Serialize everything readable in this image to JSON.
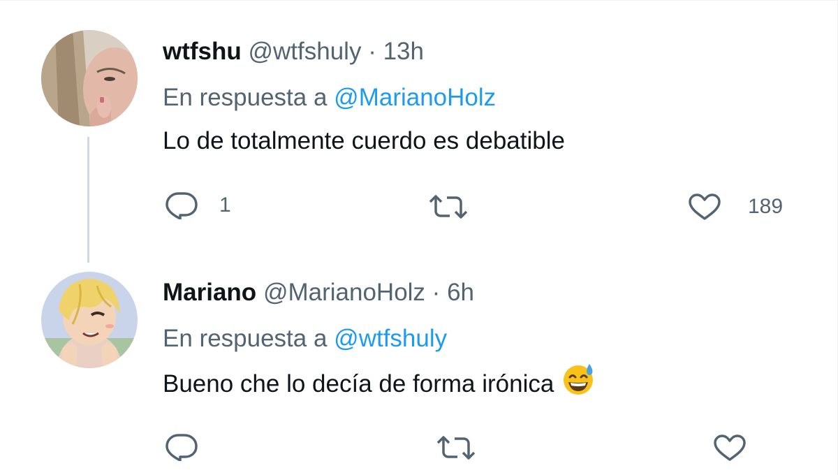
{
  "tweets": [
    {
      "display_name": "wtfshu",
      "handle": "@wtfshuly",
      "separator": "·",
      "time": "13h",
      "reply_prefix": "En respuesta a",
      "reply_to": "@MarianoHolz",
      "text": "Lo de totalmente cuerdo es debatible",
      "reply_count": "1",
      "retweet_count": "",
      "like_count": "189",
      "icons": {
        "reply": "reply-icon",
        "retweet": "retweet-icon",
        "like": "heart-icon"
      }
    },
    {
      "display_name": "Mariano",
      "handle": "@MarianoHolz",
      "separator": "·",
      "time": "6h",
      "reply_prefix": "En respuesta a",
      "reply_to": "@wtfshuly",
      "text": "Bueno che lo decía de forma irónica",
      "emoji": "grinning-face-with-sweat-emoji",
      "reply_count": "",
      "retweet_count": "",
      "like_count": "",
      "icons": {
        "reply": "reply-icon",
        "retweet": "retweet-icon",
        "like": "heart-icon"
      }
    }
  ],
  "colors": {
    "text": "#0f1419",
    "secondary": "#536471",
    "link": "#1d9bf0",
    "thread_line": "#cfd9de"
  }
}
